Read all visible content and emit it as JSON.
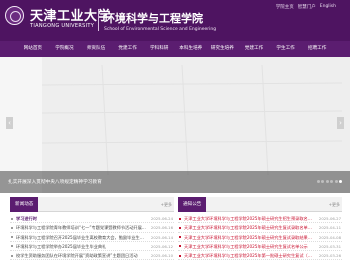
{
  "header": {
    "university_cn": "天津工业大学",
    "university_en": "TIANGONG UNIVERSITY",
    "school_cn": "环境科学与工程学院",
    "school_en": "School of Environmental Science and Engineering",
    "top_links": [
      "学院主页",
      "智慧门户",
      "English"
    ],
    "colors": {
      "header_bg": "#4e1461",
      "nav_bg": "#5b1d70"
    }
  },
  "nav": {
    "items": [
      "网站首页",
      "学院概况",
      "师资队伍",
      "党建工作",
      "学科科研",
      "本科生培养",
      "研究生培养",
      "党建工作",
      "学生工作",
      "招聘工作"
    ]
  },
  "banner": {
    "caption": "扎实开展深入贯彻中央八项规定精神学习教育"
  },
  "news": {
    "title": "新闻动态",
    "more": "+更多",
    "items": [
      {
        "title": "学习进行时",
        "date": "2025-06-24"
      },
      {
        "title": "环境科学与工程学院青年教师培训“七一”专题党课暨教师节活动开展...",
        "date": "2025-06-16"
      },
      {
        "title": "环境科学与工程学院召开2025届毕业生离校教育大会，勉励毕业生扬帆起航",
        "date": "2025-06-14"
      },
      {
        "title": "环境科学与工程学院举办2025届毕业生毕业典礼",
        "date": "2025-06-12"
      },
      {
        "title": "校学生资助服务团队在环境学院开展“资助政策宣讲”主题团日活动",
        "date": "2025-06-10"
      }
    ]
  },
  "notices": {
    "title": "通知公告",
    "more": "+更多",
    "items": [
      {
        "title": "天津工业大学环境科学与工程学院2025年硕士研究生招生预录取名单公示",
        "date": "2025-06-27"
      },
      {
        "title": "天津工业大学环境科学与工程学院2025年硕士研究生复试录取名单公示",
        "date": "2025-04-11"
      },
      {
        "title": "天津工业大学环境科学与工程学院2025年硕士研究生复试录取结果公示",
        "date": "2025-04-08"
      },
      {
        "title": "天津工业大学环境科学与工程学院2025年硕士研究生复试名单公示",
        "date": "2025-03-31"
      },
      {
        "title": "天津工业大学环境科学与工程学院2025年第一批硕士研究生复试（调剂）方案",
        "date": "2025-03-26"
      }
    ]
  }
}
